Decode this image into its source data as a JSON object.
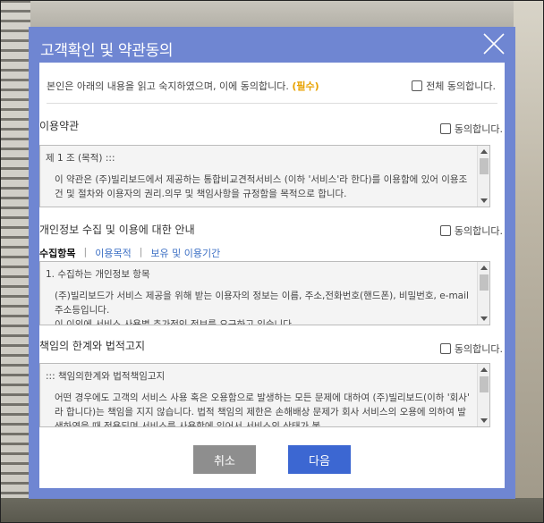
{
  "dialog": {
    "title": "고객확인 및 약관동의",
    "intro": "본인은 아래의 내용을 읽고 숙지하였으며, 이에 동의합니다.",
    "required": "(필수)",
    "agree_all": "전체 동의합니다."
  },
  "terms": {
    "title": "이용약관",
    "agree": "동의합니다.",
    "line1": "제 1 조 (목적) :::",
    "line2": "이 약관은 (주)빌리보드에서 제공하는 통합비교견적서비스 (이하 '서비스'라 한다)를 이용함에 있어 이용조건 및 절차와 이용자의 권리.의무 및 책임사항을 규정함을 목적으로 합니다."
  },
  "privacy": {
    "title": "개인정보 수집 및 이용에 대한 안내",
    "agree": "동의합니다.",
    "tabs": [
      "수집항목",
      "이용목적",
      "보유 및 이용기간"
    ],
    "line1": "1. 수집하는 개인정보 항목",
    "line2": "(주)빌리보드가 서비스 제공을 위해 받는 이용자의 정보는 이름, 주소,전화번호(핸드폰), 비밀번호, e-mail 주소등입니다.",
    "line3": "이 이외에 서비스 사용별 추가적인 정보를 요구하고 있습니다."
  },
  "liability": {
    "title": "책임의 한계와 법적고지",
    "agree": "동의합니다.",
    "line1": "::: 책임의한계와 법적책임고지",
    "line2": "어떤 경우에도 고객의 서비스 사용 혹은 오용함으로 발생하는 모든 문제에 대하여 (주)빌리보드(이하 '회사' 라 합니다)는 책임을 지지 않습니다. 법적 책임의 제한은 손해배상 문제가 회사 서비스의 오용에 의하여 발생하였을 때 적용되며 서비스를 사용함에 있어서 서비스의 상태가 불"
  },
  "buttons": {
    "cancel": "취소",
    "next": "다음"
  }
}
